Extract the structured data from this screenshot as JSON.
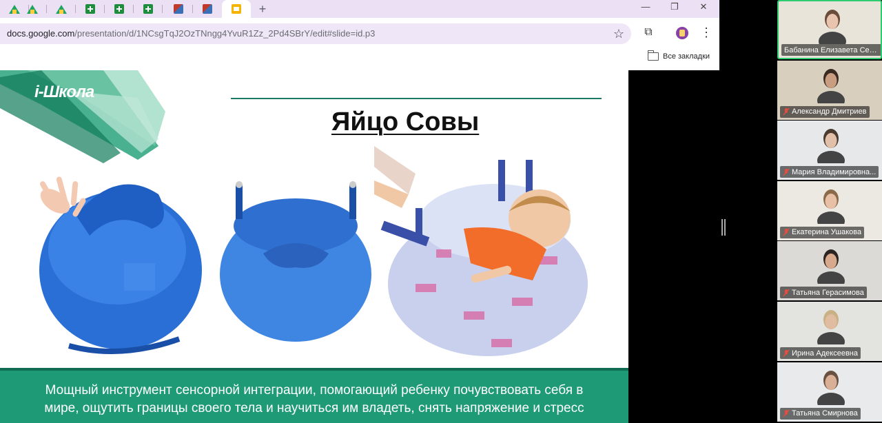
{
  "browser": {
    "tabs": [
      {
        "icon": "drive-icon",
        "active": false
      },
      {
        "icon": "drive-icon",
        "active": false
      },
      {
        "icon": "drive-icon",
        "active": false
      },
      {
        "icon": "sheets-icon",
        "active": false
      },
      {
        "icon": "sheets-icon",
        "active": false
      },
      {
        "icon": "sheets-icon",
        "active": false
      },
      {
        "icon": "image-icon",
        "active": false
      },
      {
        "icon": "image-icon",
        "active": false
      },
      {
        "icon": "slides-icon",
        "active": true
      }
    ],
    "new_tab_label": "+",
    "window_controls": {
      "minimize": "—",
      "restore": "❐",
      "close": "✕"
    },
    "url_host": "docs.google.com",
    "url_path": "/presentation/d/1NCsgTqJ2OzTNngg4YvuR1Zz_2Pd4SBrY/edit#slide=id.p3",
    "bookmarks_all_label": "Все закладки",
    "accent": "#ece0f5"
  },
  "slide": {
    "logo": "i-Школа",
    "title": "Яйцо Совы",
    "caption_line1": "Мощный инструмент сенсорной интеграции, помогающий ребенку почувствовать себя в",
    "caption_line2": "мире, ощутить границы своего тела и научиться им владеть, снять напряжение и стресс",
    "accent": "#1e9a76"
  },
  "participants": [
    {
      "name": "Бабанина Елизавета Серг...",
      "muted": false,
      "speaking": true
    },
    {
      "name": "Александр Дмитриев",
      "muted": true,
      "speaking": false
    },
    {
      "name": "Мария Владимировна...",
      "muted": true,
      "speaking": false
    },
    {
      "name": "Екатерина Ушакова",
      "muted": true,
      "speaking": false
    },
    {
      "name": "Татьяна Герасимова",
      "muted": true,
      "speaking": false
    },
    {
      "name": "Ирина Адексеевна",
      "muted": true,
      "speaking": false
    },
    {
      "name": "Татьяна Смирнова",
      "muted": true,
      "speaking": false
    }
  ]
}
